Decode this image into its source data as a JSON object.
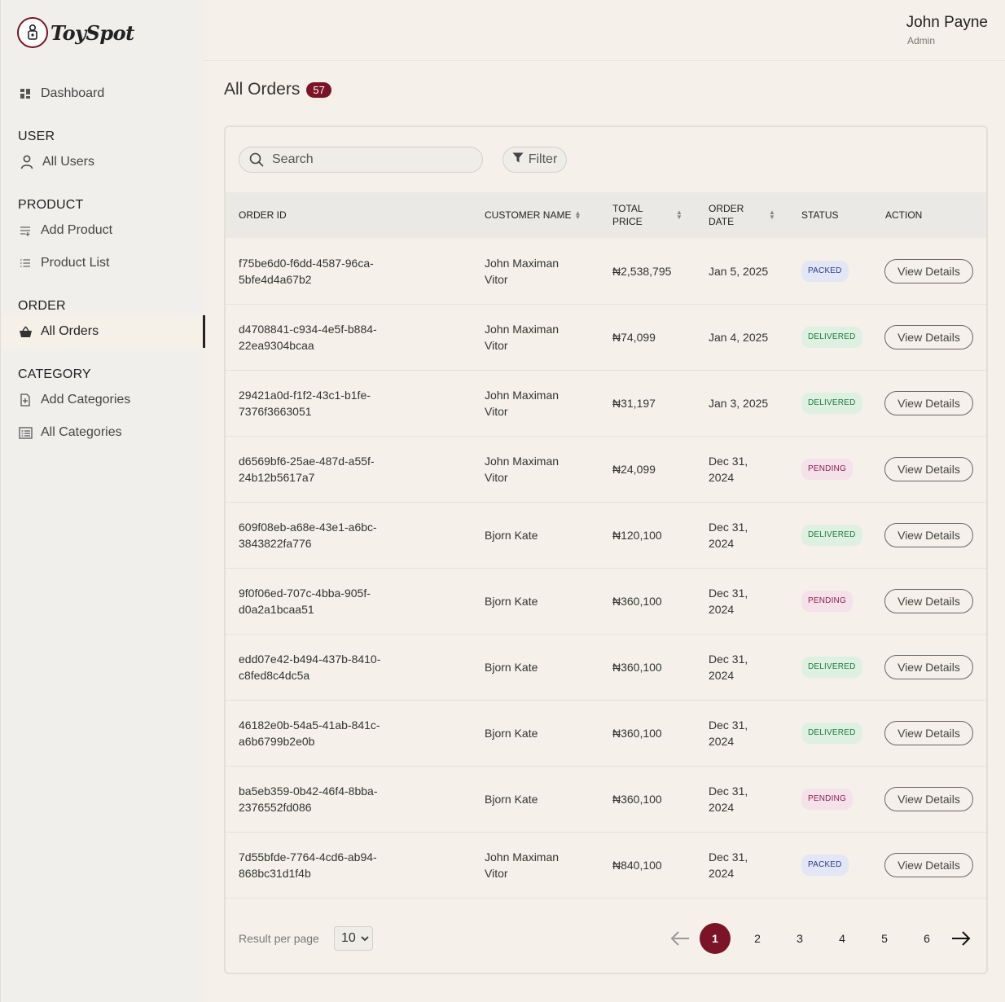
{
  "app": {
    "name": "ToySpot"
  },
  "sidebar": {
    "dashboard": "Dashboard",
    "sections": {
      "user": "USER",
      "product": "PRODUCT",
      "order": "ORDER",
      "category": "CATEGORY"
    },
    "items": {
      "all_users": "All Users",
      "add_product": "Add Product",
      "product_list": "Product List",
      "all_orders": "All Orders",
      "add_categories": "Add Categories",
      "all_categories": "All Categories"
    }
  },
  "header": {
    "user_name": "John Payne",
    "user_role": "Admin"
  },
  "page": {
    "title": "All Orders",
    "count": "57"
  },
  "toolbar": {
    "search_placeholder": "Search",
    "filter_label": "Filter"
  },
  "table": {
    "columns": {
      "order_id": "ORDER ID",
      "customer_name": "CUSTOMER NAME",
      "total_price_line1": "TOTAL",
      "total_price_line2": "PRICE",
      "order_date_line1": "ORDER",
      "order_date_line2": "DATE",
      "status": "STATUS",
      "action": "ACTION"
    },
    "rows": [
      {
        "id_line1": "f75be6d0-f6dd-4587-96ca-",
        "id_line2": "5bfe4d4a67b2",
        "name_line1": "John Maximan",
        "name_line2": "Vitor",
        "total": "₦2,538,795",
        "date_line1": "Jan 5, 2025",
        "date_line2": "",
        "status": "PACKED",
        "action": "View Details"
      },
      {
        "id_line1": "d4708841-c934-4e5f-b884-",
        "id_line2": "22ea9304bcaa",
        "name_line1": "John Maximan",
        "name_line2": "Vitor",
        "total": "₦74,099",
        "date_line1": "Jan 4, 2025",
        "date_line2": "",
        "status": "DELIVERED",
        "action": "View Details"
      },
      {
        "id_line1": "29421a0d-f1f2-43c1-b1fe-",
        "id_line2": "7376f3663051",
        "name_line1": "John Maximan",
        "name_line2": "Vitor",
        "total": "₦31,197",
        "date_line1": "Jan 3, 2025",
        "date_line2": "",
        "status": "DELIVERED",
        "action": "View Details"
      },
      {
        "id_line1": "d6569bf6-25ae-487d-a55f-",
        "id_line2": "24b12b5617a7",
        "name_line1": "John Maximan",
        "name_line2": "Vitor",
        "total": "₦24,099",
        "date_line1": "Dec 31,",
        "date_line2": "2024",
        "status": "PENDING",
        "action": "View Details"
      },
      {
        "id_line1": "609f08eb-a68e-43e1-a6bc-",
        "id_line2": "3843822fa776",
        "name_line1": "Bjorn Kate",
        "name_line2": "",
        "total": "₦120,100",
        "date_line1": "Dec 31,",
        "date_line2": "2024",
        "status": "DELIVERED",
        "action": "View Details"
      },
      {
        "id_line1": "9f0f06ed-707c-4bba-905f-",
        "id_line2": "d0a2a1bcaa51",
        "name_line1": "Bjorn Kate",
        "name_line2": "",
        "total": "₦360,100",
        "date_line1": "Dec 31,",
        "date_line2": "2024",
        "status": "PENDING",
        "action": "View Details"
      },
      {
        "id_line1": "edd07e42-b494-437b-8410-",
        "id_line2": "c8fed8c4dc5a",
        "name_line1": "Bjorn Kate",
        "name_line2": "",
        "total": "₦360,100",
        "date_line1": "Dec 31,",
        "date_line2": "2024",
        "status": "DELIVERED",
        "action": "View Details"
      },
      {
        "id_line1": "46182e0b-54a5-41ab-841c-",
        "id_line2": "a6b6799b2e0b",
        "name_line1": "Bjorn Kate",
        "name_line2": "",
        "total": "₦360,100",
        "date_line1": "Dec 31,",
        "date_line2": "2024",
        "status": "DELIVERED",
        "action": "View Details"
      },
      {
        "id_line1": "ba5eb359-0b42-46f4-8bba-",
        "id_line2": "2376552fd086",
        "name_line1": "Bjorn Kate",
        "name_line2": "",
        "total": "₦360,100",
        "date_line1": "Dec 31,",
        "date_line2": "2024",
        "status": "PENDING",
        "action": "View Details"
      },
      {
        "id_line1": "7d55bfde-7764-4cd6-ab94-",
        "id_line2": "868bc31d1f4b",
        "name_line1": "John Maximan",
        "name_line2": "Vitor",
        "total": "₦840,100",
        "date_line1": "Dec 31,",
        "date_line2": "2024",
        "status": "PACKED",
        "action": "View Details"
      }
    ]
  },
  "pagination": {
    "result_label": "Result per page",
    "per_page": "10",
    "pages": [
      "1",
      "2",
      "3",
      "4",
      "5",
      "6"
    ],
    "current": "1"
  },
  "colors": {
    "brand": "#7a1426",
    "background": "#f5f1ea"
  }
}
